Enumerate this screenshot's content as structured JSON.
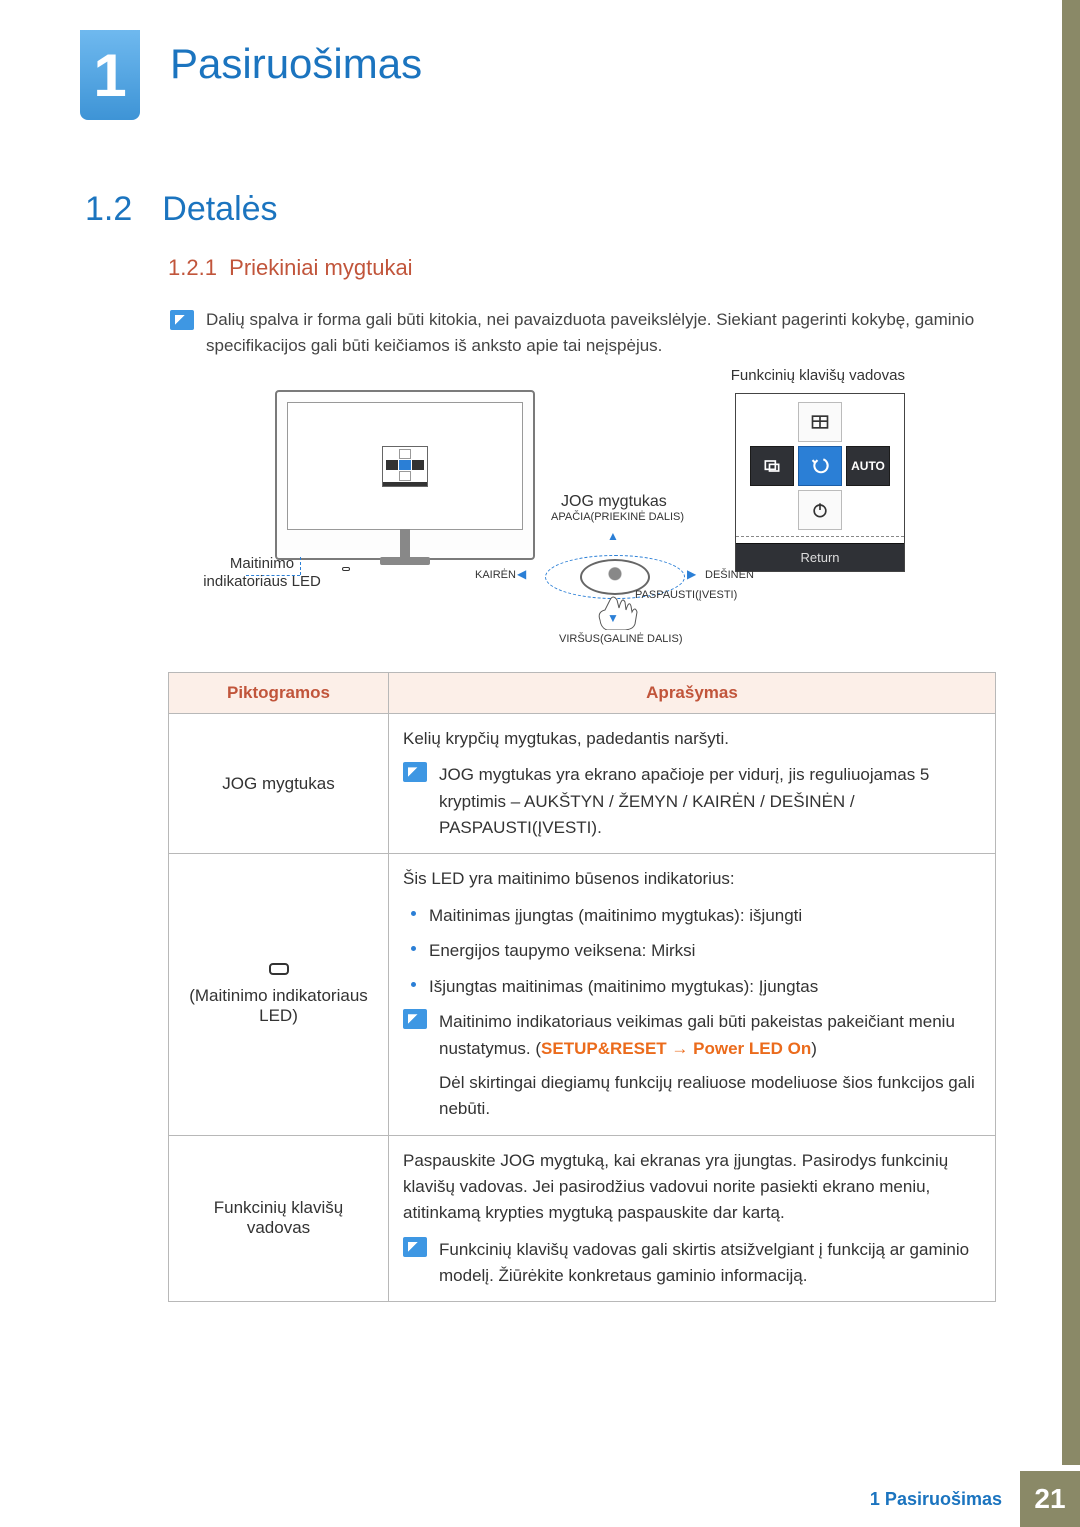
{
  "chapter": {
    "number": "1",
    "title": "Pasiruošimas"
  },
  "section": {
    "number": "1.2",
    "title": "Detalės"
  },
  "subsection": {
    "number": "1.2.1",
    "title": "Priekiniai mygtukai"
  },
  "intro_note": "Dalių spalva ir forma gali būti kitokia, nei pavaizduota paveikslėlyje. Siekiant pagerinti kokybę, gaminio specifikacijos gali būti keičiamos iš anksto apie tai neįspėjus.",
  "diagram": {
    "fn_guide_label": "Funkcinių klavišų vadovas",
    "jog_label": "JOG mygtukas",
    "led_label_line1": "Maitinimo",
    "led_label_line2": "indikatoriaus LED",
    "return_label": "Return",
    "auto_label": "AUTO",
    "dir_up": "APAČIA(PRIEKINĖ DALIS)",
    "dir_left": "KAIRĖN",
    "dir_right": "DEŠINĖN",
    "dir_press": "PASPAUSTI(ĮVESTI)",
    "dir_down": "VIRŠUS(GALINĖ DALIS)"
  },
  "table": {
    "headers": {
      "col1": "Piktogramos",
      "col2": "Aprašymas"
    },
    "rows": [
      {
        "label": "JOG mygtukas",
        "main": "Kelių krypčių mygtukas, padedantis naršyti.",
        "note": "JOG mygtukas yra ekrano apačioje per vidurį, jis reguliuojamas 5 kryptimis – AUKŠTYN / ŽEMYN / KAIRĖN / DEŠINĖN / PASPAUSTI(ĮVESTI)."
      },
      {
        "label": "(Maitinimo indikatoriaus LED)",
        "main": "Šis LED yra maitinimo būsenos indikatorius:",
        "bullets": [
          "Maitinimas įjungtas (maitinimo mygtukas): išjungti",
          "Energijos taupymo veiksena: Mirksi",
          "Išjungtas maitinimas (maitinimo mygtukas): Įjungtas"
        ],
        "note_pre": "Maitinimo indikatoriaus veikimas gali būti pakeistas pakeičiant meniu nustatymus. (",
        "note_path1": "SETUP&RESET",
        "note_arrow": " → ",
        "note_path2": "Power LED On",
        "note_post": ")",
        "note_extra": "Dėl skirtingai diegiamų funkcijų realiuose modeliuose šios funkcijos gali nebūti."
      },
      {
        "label": "Funkcinių klavišų vadovas",
        "main": "Paspauskite JOG mygtuką, kai ekranas yra įjungtas. Pasirodys funkcinių klavišų vadovas. Jei pasirodžius vadovui norite pasiekti ekrano meniu, atitinkamą krypties mygtuką paspauskite dar kartą.",
        "note": "Funkcinių klavišų vadovas gali skirtis atsižvelgiant į funkciją ar gaminio modelį. Žiūrėkite konkretaus gaminio informaciją."
      }
    ]
  },
  "footer": {
    "label": "1 Pasiruošimas",
    "page": "21"
  }
}
